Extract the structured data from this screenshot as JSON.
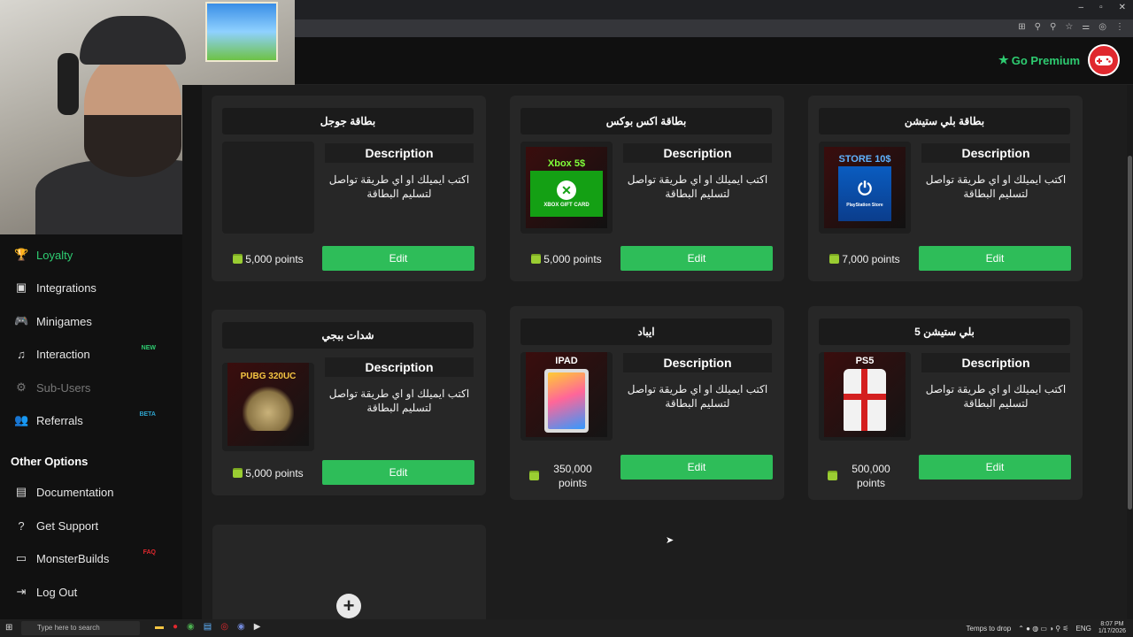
{
  "browser": {
    "window_controls": [
      "–",
      "▫",
      "✕"
    ],
    "addr_icons": [
      "⊞",
      "⚲",
      "⚲",
      "☆",
      "⚌",
      "◎",
      "⋮"
    ]
  },
  "topnav": {
    "premium_label": "Go Premium"
  },
  "sidebar": {
    "items": [
      {
        "label": "Loyalty",
        "icon": "trophy-icon",
        "glyph": "🏆"
      },
      {
        "label": "Integrations",
        "icon": "integrations-icon",
        "glyph": "▣"
      },
      {
        "label": "Minigames",
        "icon": "gamepad-icon",
        "glyph": "🎮"
      },
      {
        "label": "Interaction",
        "icon": "music-icon",
        "glyph": "♫",
        "badge": "NEW"
      },
      {
        "label": "Sub-Users",
        "icon": "gear-icon",
        "glyph": "⚙"
      },
      {
        "label": "Referrals",
        "icon": "users-icon",
        "glyph": "👥",
        "badge": "BETA"
      }
    ],
    "other_title": "Other Options",
    "other_items": [
      {
        "label": "Documentation",
        "icon": "book-icon",
        "glyph": "▤"
      },
      {
        "label": "Get Support",
        "icon": "help-icon",
        "glyph": "?"
      },
      {
        "label": "MonsterBuilds",
        "icon": "monitor-icon",
        "glyph": "▭",
        "badge": "FAQ"
      },
      {
        "label": "Log Out",
        "icon": "logout-icon",
        "glyph": "⇥"
      }
    ]
  },
  "rewards": {
    "description_heading": "Description",
    "description_text": "اكتب ايميلك او اي طريقة تواصل لتسليم البطاقة",
    "edit_label": "Edit",
    "cards": [
      {
        "title": "بطاقة جوجل",
        "points": "5,000 points",
        "image": "google-card",
        "image_text": ""
      },
      {
        "title": "بطاقة اكس بوكس",
        "points": "5,000 points",
        "image": "xbox-card",
        "image_text": "Xbox 5$",
        "image_sub": "XBOX GIFT CARD"
      },
      {
        "title": "بطاقة بلي ستيشن",
        "points": "7,000 points",
        "image": "playstation-card",
        "image_text": "STORE 10$",
        "image_sub": "PlayStation Store"
      },
      {
        "title": "شدات ببجي",
        "points": "5,000 points",
        "image": "pubg-card",
        "image_text": "PUBG 320UC"
      },
      {
        "title": "ايباد",
        "points": "350,000 points",
        "image": "ipad-card",
        "image_text": "IPAD"
      },
      {
        "title": "بلي ستيشن 5",
        "points": "500,000 points",
        "image": "ps5-card",
        "image_text": "PS5"
      }
    ],
    "add_glyph": "+"
  },
  "taskbar": {
    "search_placeholder": "Type here to search",
    "weather": "Temps to drop",
    "lang": "ENG",
    "time": "8:07 PM",
    "date": "1/17/2026"
  }
}
